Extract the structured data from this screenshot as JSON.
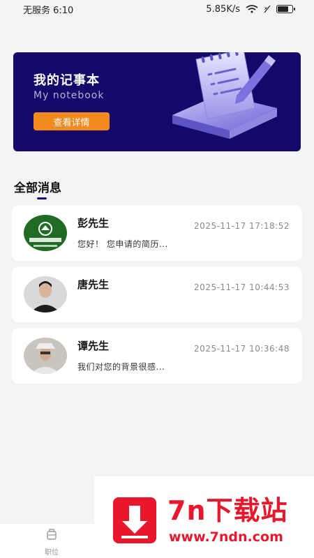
{
  "status_bar": {
    "carrier_time": "无服务 6:10",
    "net_speed": "5.85K/s",
    "icons": [
      "wifi-icon",
      "no-signal-icon",
      "battery-icon"
    ]
  },
  "banner": {
    "title": "我的记事本",
    "subtitle": "My notebook",
    "button_label": "查看详情",
    "colors": {
      "background": "#14086a",
      "button": "#f28a1e"
    }
  },
  "section": {
    "title": "全部消息"
  },
  "messages": [
    {
      "name": "彭先生",
      "time": "2025-11-17 17:18:52",
      "preview": "您好！ 您申请的简历...",
      "avatar": "company-logo-avatar"
    },
    {
      "name": "唐先生",
      "time": "2025-11-17 10:44:53",
      "preview": "",
      "avatar": "person-avatar"
    },
    {
      "name": "谭先生",
      "time": "2025-11-17 10:36:48",
      "preview": "我们对您的背景很感...",
      "avatar": "person-avatar"
    }
  ],
  "tabbar": {
    "items": [
      {
        "label": "职位",
        "icon": "briefcase-icon"
      }
    ]
  },
  "watermark": {
    "text": "7n下载站",
    "url": "www.7ndn.com"
  }
}
